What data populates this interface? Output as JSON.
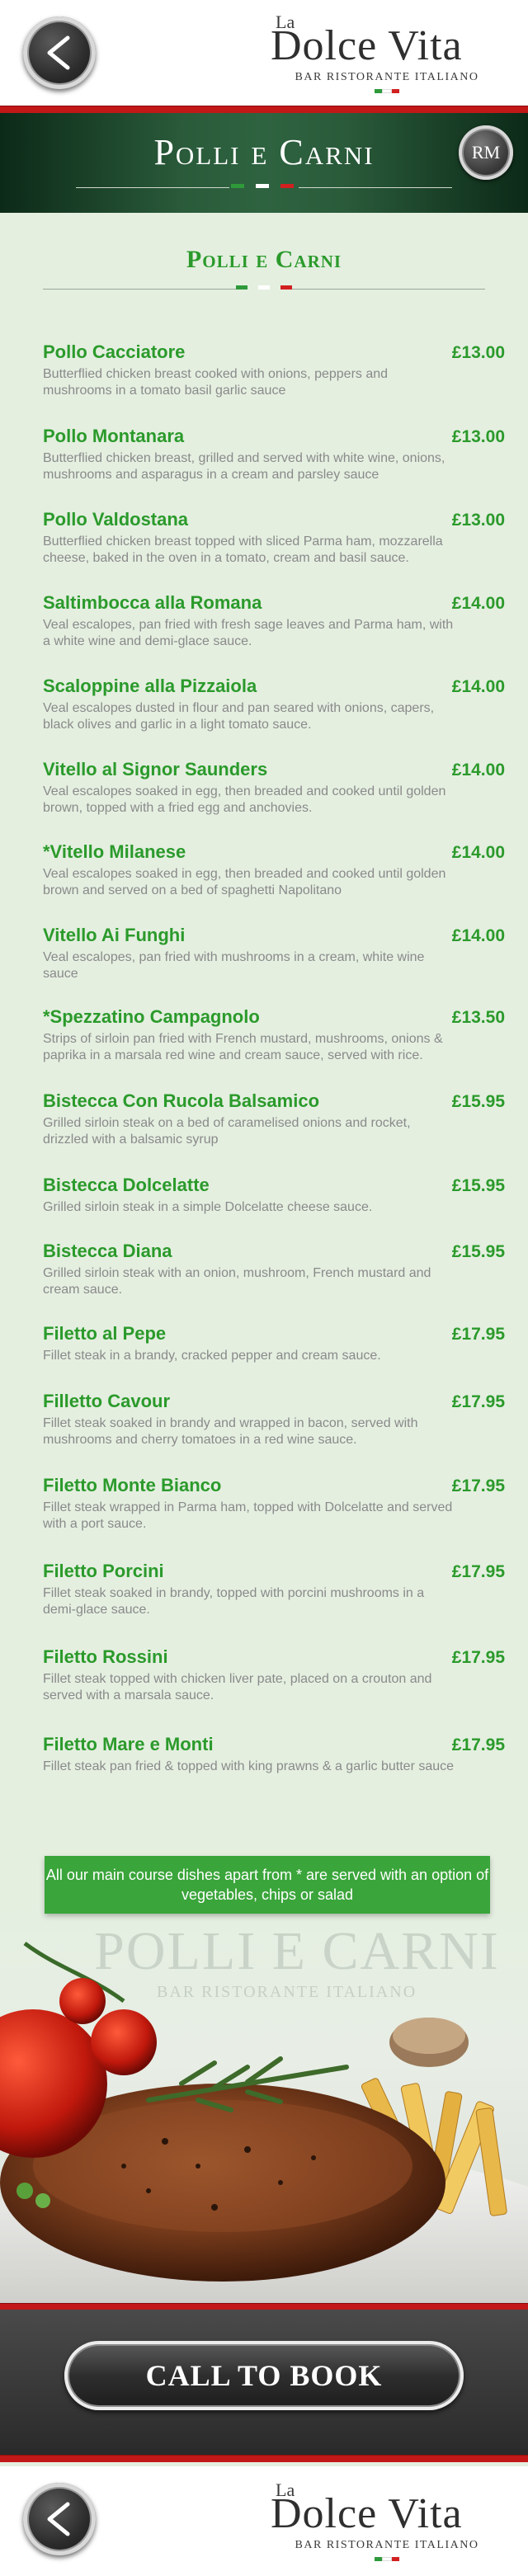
{
  "header": {
    "logo_la": "La",
    "logo_name": "Dolce Vita",
    "logo_sub": "BAR RISTORANTE ITALIANO",
    "back_icon": "chevron-left-icon"
  },
  "title_band": {
    "title": "Polli e Carni",
    "rm_label": "RM"
  },
  "section": {
    "title": "Polli e Carni"
  },
  "colors": {
    "accent_green": "#2b9a2b",
    "flag_green": "#2e9a3a",
    "flag_white": "#ffffff",
    "flag_red": "#d22020",
    "brand_red": "#c21818"
  },
  "items": [
    {
      "name": "Pollo Cacciatore",
      "price": "£13.00",
      "desc": "Butterflied chicken breast cooked with onions, peppers and mushrooms in a tomato basil garlic sauce"
    },
    {
      "name": "Pollo Montanara",
      "price": "£13.00",
      "desc": "Butterflied chicken breast, grilled and served with white wine, onions, mushrooms and asparagus in a cream and parsley sauce"
    },
    {
      "name": "Pollo Valdostana",
      "price": "£13.00",
      "desc": "Butterflied chicken breast topped with sliced Parma ham, mozzarella cheese, baked in the oven in a tomato, cream and basil sauce."
    },
    {
      "name": "Saltimbocca alla Romana",
      "price": "£14.00",
      "desc": "Veal escalopes, pan fried with fresh sage leaves and Parma ham, with a white wine and demi-glace sauce."
    },
    {
      "name": "Scaloppine alla Pizzaiola",
      "price": "£14.00",
      "desc": "Veal escalopes dusted in flour and pan seared with onions, capers, black olives and garlic in a light tomato sauce."
    },
    {
      "name": "Vitello al Signor Saunders",
      "price": "£14.00",
      "desc": "Veal escalopes soaked in egg, then breaded and cooked until golden brown, topped with a fried egg and anchovies."
    },
    {
      "name": "*Vitello Milanese",
      "price": "£14.00",
      "desc": "Veal escalopes soaked in egg, then breaded and cooked until golden brown and served on a bed of spaghetti Napolitano"
    },
    {
      "name": "Vitello Ai Funghi",
      "price": "£14.00",
      "desc": "Veal escalopes, pan fried with mushrooms in a cream, white wine sauce"
    },
    {
      "name": "*Spezzatino Campagnolo",
      "price": "£13.50",
      "desc": "Strips of sirloin pan fried with French mustard, mushrooms, onions & paprika in a marsala red wine and cream sauce, served with rice."
    },
    {
      "name": "Bistecca Con Rucola Balsamico",
      "price": "£15.95",
      "desc": "Grilled sirloin steak on a bed of caramelised onions and rocket, drizzled with a balsamic syrup"
    },
    {
      "name": "Bistecca Dolcelatte",
      "price": "£15.95",
      "desc": "Grilled sirloin steak in a simple Dolcelatte cheese sauce."
    },
    {
      "name": "Bistecca Diana",
      "price": "£15.95",
      "desc": "Grilled sirloin steak with an onion, mushroom, French mustard and cream sauce."
    },
    {
      "name": "Filetto al Pepe",
      "price": "£17.95",
      "desc": "Fillet steak in a brandy, cracked pepper and cream sauce."
    },
    {
      "name": "Filletto Cavour",
      "price": "£17.95",
      "desc": "Fillet steak soaked in brandy and wrapped in bacon, served with mushrooms and cherry tomatoes in a red wine sauce."
    },
    {
      "name": "Filetto Monte Bianco",
      "price": "£17.95",
      "desc": "Fillet steak wrapped in Parma ham, topped with Dolcelatte and served with a port sauce."
    },
    {
      "name": "Filetto Porcini",
      "price": "£17.95",
      "desc": "Fillet steak soaked in brandy, topped with porcini mushrooms in a demi-glace sauce."
    },
    {
      "name": "Filetto Rossini",
      "price": "£17.95",
      "desc": "Fillet steak topped with chicken liver pate, placed on a crouton and served with a marsala sauce."
    },
    {
      "name": "Filetto Mare e Monti",
      "price": "£17.95",
      "desc": "Fillet steak pan fried & topped with king prawns & a garlic butter sauce"
    }
  ],
  "note": "All our main course dishes apart from * are served with an option of vegetables, chips or salad",
  "watermark": {
    "title": "POLLI E CARNI",
    "sub": "BAR RISTORANTE ITALIANO"
  },
  "cta": {
    "label": "CALL TO BOOK"
  }
}
